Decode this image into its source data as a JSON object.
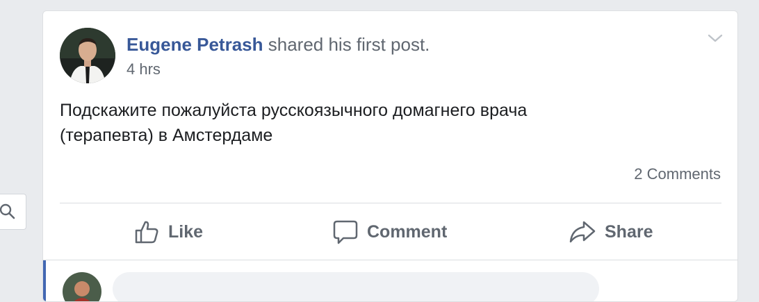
{
  "post": {
    "author": "Eugene Petrash",
    "action": "shared his first post.",
    "timestamp": "4 hrs",
    "text_line1": "Подскажите пожалуйста русскоязычного домагнего врача",
    "text_line2": "(терапевта) в Амстердаме",
    "comments_count": "2 Comments"
  },
  "actions": {
    "like": "Like",
    "comment": "Comment",
    "share": "Share"
  },
  "icons": {
    "search": "search-icon",
    "options": "chevron-down-icon",
    "like": "thumbs-up-icon",
    "comment": "speech-bubble-icon",
    "share": "share-arrow-icon"
  },
  "colors": {
    "author_link": "#385898",
    "secondary_text": "#606770",
    "main_text": "#1c1e21",
    "accent_bar": "#4267b2",
    "page_background": "#e9ebee"
  }
}
